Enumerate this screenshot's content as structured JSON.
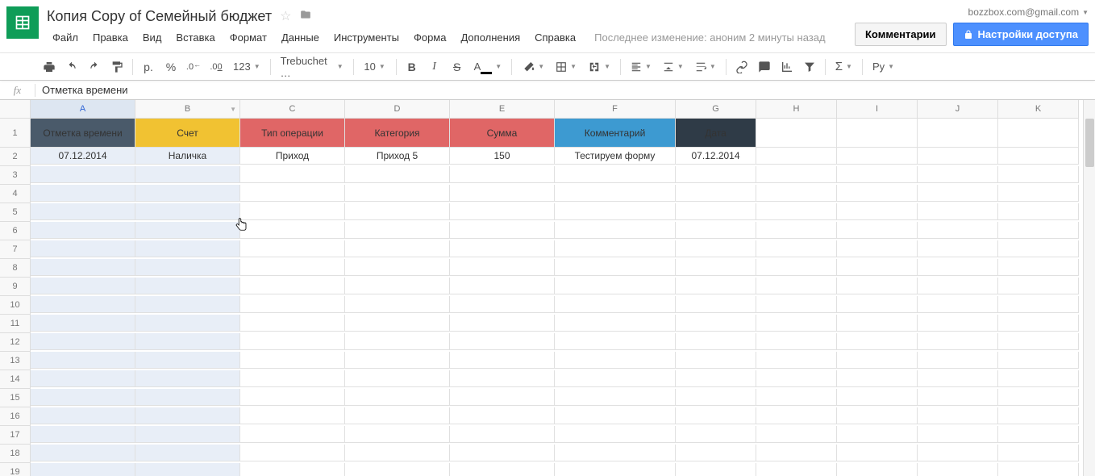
{
  "doc": {
    "title": "Копия Copy of Семейный бюджет",
    "account": "bozzbox.com@gmail.com",
    "comments_btn": "Комментарии",
    "share_btn": "Настройки доступа",
    "last_edit": "Последнее изменение: аноним 2 минуты назад"
  },
  "menus": [
    "Файл",
    "Правка",
    "Вид",
    "Вставка",
    "Формат",
    "Данные",
    "Инструменты",
    "Форма",
    "Дополнения",
    "Справка"
  ],
  "toolbar": {
    "currency": "р.",
    "percent": "%",
    "dec_less": ".0_",
    "dec_more": ".0̲0",
    "formats": "123",
    "font": "Trebuchet …",
    "size": "10",
    "lang": "Ру"
  },
  "formula": {
    "fx": "fx",
    "value": "Отметка времени"
  },
  "columns": [
    "A",
    "B",
    "C",
    "D",
    "E",
    "F",
    "G",
    "H",
    "I",
    "J",
    "K"
  ],
  "headers": {
    "a": "Отметка времени",
    "b": "Счет",
    "c": "Тип операции",
    "d": "Категория",
    "e": "Сумма",
    "f": "Комментарий",
    "g": "Дата"
  },
  "row2": {
    "a": "07.12.2014",
    "b": "Наличка",
    "c": "Приход",
    "d": "Приход 5",
    "e": "150",
    "f": "Тестируем форму",
    "g": "07.12.2014"
  },
  "row_numbers": [
    "1",
    "2",
    "3",
    "4",
    "5",
    "6",
    "7",
    "8",
    "9",
    "10",
    "11",
    "12",
    "13",
    "14",
    "15",
    "16",
    "17",
    "18",
    "19"
  ]
}
